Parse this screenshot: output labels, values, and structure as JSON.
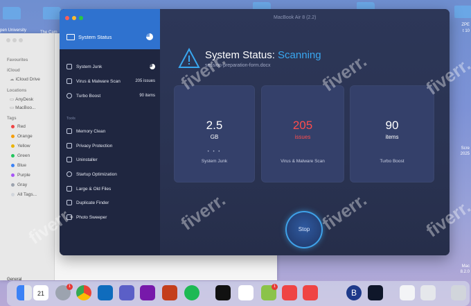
{
  "desktop": {
    "folder_labels": [
      "pen University",
      "The Cam"
    ],
    "right_texts": [
      "ZPE",
      "t 10",
      "Scre",
      "2025",
      "Mac",
      "8.2.0"
    ],
    "dock_general_label": "General"
  },
  "finder": {
    "favourites_header": "Favourites",
    "icloud_header": "iCloud",
    "icloud_drive": "iCloud Drive",
    "locations_header": "Locations",
    "locations": [
      "AnyDesk",
      "MacBoo..."
    ],
    "tags_header": "Tags",
    "tags": [
      {
        "label": "Red",
        "color": "#ef4444"
      },
      {
        "label": "Orange",
        "color": "#f59e0b"
      },
      {
        "label": "Yellow",
        "color": "#eab308"
      },
      {
        "label": "Green",
        "color": "#22c55e"
      },
      {
        "label": "Blue",
        "color": "#3b82f6"
      },
      {
        "label": "Purple",
        "color": "#a855f7"
      },
      {
        "label": "Gray",
        "color": "#9ca3af"
      },
      {
        "label": "All Tags...",
        "color": "#d1d5db"
      }
    ]
  },
  "app": {
    "window_title": "MacBook Air 8 (2.2)",
    "sidebar": {
      "header_title": "System Status",
      "items": [
        {
          "label": "System Junk",
          "value": ""
        },
        {
          "label": "Virus & Malware Scan",
          "value": "205 issues"
        },
        {
          "label": "Turbo Boost",
          "value": "90 items"
        }
      ],
      "tools_label": "Tools",
      "tools": [
        "Memory Clean",
        "Privacy Protection",
        "Uninstaller",
        "Startup Optimization",
        "Large & Old Files",
        "Duplicate Finder",
        "Photo Sweeper"
      ]
    },
    "main": {
      "title_prefix": "System Status:",
      "title_state": "Scanning",
      "current_file": "session-preparation-form.docx",
      "cards": [
        {
          "number": "2.5",
          "unit": "GB",
          "label": "System Junk",
          "color": "#ffffff"
        },
        {
          "number": "205",
          "unit": "issues",
          "label": "Virus & Malware Scan",
          "color": "#ff4d4d"
        },
        {
          "number": "90",
          "unit": "items",
          "label": "Turbo Boost",
          "color": "#ffffff"
        }
      ],
      "stop_label": "Stop",
      "accent_color": "#39a7f0"
    }
  },
  "watermark": "fiverr.",
  "dock": {
    "calendar_day": "21",
    "badges": [
      "1",
      "1"
    ]
  }
}
